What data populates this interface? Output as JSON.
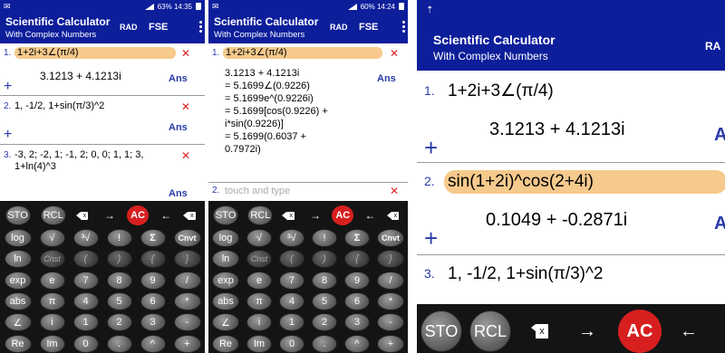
{
  "app": {
    "title": "Scientific Calculator",
    "subtitle": "With Complex Numbers",
    "angle_mode": "RAD",
    "format_mode": "FSE"
  },
  "panel1": {
    "status": {
      "right": "63% 14:35"
    },
    "entries": [
      {
        "num": "1.",
        "expr": "1+2i+3∠(π/4)",
        "result": "3.1213 + 4.1213i",
        "ans": "Ans"
      },
      {
        "num": "2.",
        "expr": "1, -1/2, 1+sin(π/3)^2",
        "ans": "Ans"
      },
      {
        "num": "3.",
        "expr_line1": "-3, 2;  -2, 1;  -1, 2;  0, 0;  1, 1;  3,",
        "expr_line2": "1+ln(4)^3",
        "ans": "Ans"
      }
    ]
  },
  "panel2": {
    "status": {
      "right": "60% 14:24"
    },
    "entries": [
      {
        "num": "1.",
        "expr": "1+2i+3∠(π/4)",
        "ans": "Ans",
        "lines": [
          "3.1213 + 4.1213i",
          "= 5.1699∠(0.9226)",
          "= 5.1699e^(0.9226i)",
          "= 5.1699[cos(0.9226) +",
          "i*sin(0.9226)]",
          "= 5.1699(0.6037 +",
          "0.7972i)"
        ]
      }
    ],
    "placeholder": "touch and type"
  },
  "panel3": {
    "entries": [
      {
        "num": "1.",
        "expr": "1+2i+3∠(π/4)",
        "result": "3.1213 + 4.1213i",
        "ans": "A"
      },
      {
        "num": "2.",
        "expr": "sin(1+2i)^cos(2+4i)",
        "result": "0.1049 + -0.2871i",
        "ans": "A"
      },
      {
        "num": "3.",
        "expr": "1, -1/2, 1+sin(π/3)^2"
      }
    ],
    "header_cut": "RA"
  },
  "keyboard": {
    "top": [
      "STO",
      "RCL",
      "x",
      "→",
      "AC",
      "←",
      "x"
    ],
    "rows": [
      [
        "log",
        "√",
        "³√",
        "!",
        "Σ",
        "Cnvt"
      ],
      [
        "ln",
        "Cnst",
        "(",
        ")",
        "{",
        "}"
      ],
      [
        "exp",
        "e",
        "7",
        "8",
        "9",
        "/"
      ],
      [
        "abs",
        "π",
        "4",
        "5",
        "6",
        "*"
      ],
      [
        "∠",
        "i",
        "1",
        "2",
        "3",
        "-"
      ],
      [
        "Re",
        "Im",
        "0",
        ".",
        "^",
        "+"
      ]
    ]
  },
  "symbols": {
    "plus": "+",
    "delete": "✕"
  },
  "colors": {
    "appbar": "#0d1e9b",
    "accent": "#2a3aa8",
    "highlight": "#f6c98c",
    "ac": "#d71f1f",
    "delete": "#dd2222"
  }
}
